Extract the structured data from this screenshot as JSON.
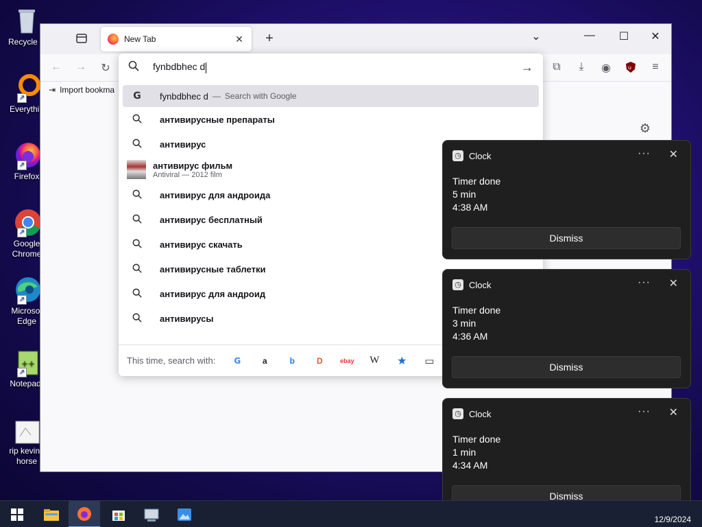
{
  "desktop": {
    "icons": [
      {
        "label": "Recycle B",
        "icon": "recycle-bin-icon"
      },
      {
        "label": "Everythin",
        "icon": "everything-icon"
      },
      {
        "label": "Firefox",
        "icon": "firefox-icon"
      },
      {
        "label": "Google Chrome",
        "icon": "chrome-icon"
      },
      {
        "label": "Microsof Edge",
        "icon": "edge-icon"
      },
      {
        "label": "Notepad-",
        "icon": "notepad-plus-icon"
      },
      {
        "label": "rip kevin t horse",
        "icon": "image-file-icon"
      }
    ]
  },
  "browser": {
    "tab_title": "New Tab",
    "bookmark_import": "Import bookma",
    "url_text": "fynbdbhec d",
    "suggestions": [
      {
        "text": "fynbdbhec d",
        "action": "Search with Google",
        "type": "google"
      },
      {
        "text": "антивирусные препараты",
        "type": "search"
      },
      {
        "text": "антивирус",
        "type": "search"
      },
      {
        "text": "антивирус фильм",
        "sub": "Antiviral — 2012 film",
        "type": "rich"
      },
      {
        "text": "антивирус для андроида",
        "type": "search"
      },
      {
        "text": "антивирус бесплатный",
        "type": "search"
      },
      {
        "text": "антивирус скачать",
        "type": "search"
      },
      {
        "text": "антивирусные таблетки",
        "type": "search"
      },
      {
        "text": "антивирус для андроид",
        "type": "search"
      },
      {
        "text": "антивирусы",
        "type": "search"
      }
    ],
    "search_with_label": "This time, search with:",
    "engines": [
      "G",
      "a",
      "b",
      "D",
      "ebay",
      "W",
      "★",
      "▭"
    ],
    "sep": "—"
  },
  "notifications": [
    {
      "app": "Clock",
      "title": "Timer done",
      "line1": "5 min",
      "line2": "4:38 AM",
      "button": "Dismiss"
    },
    {
      "app": "Clock",
      "title": "Timer done",
      "line1": "3 min",
      "line2": "4:36 AM",
      "button": "Dismiss"
    },
    {
      "app": "Clock",
      "title": "Timer done",
      "line1": "1 min",
      "line2": "4:34 AM",
      "button": "Dismiss"
    }
  ],
  "taskbar": {
    "date": "12/9/2024"
  }
}
